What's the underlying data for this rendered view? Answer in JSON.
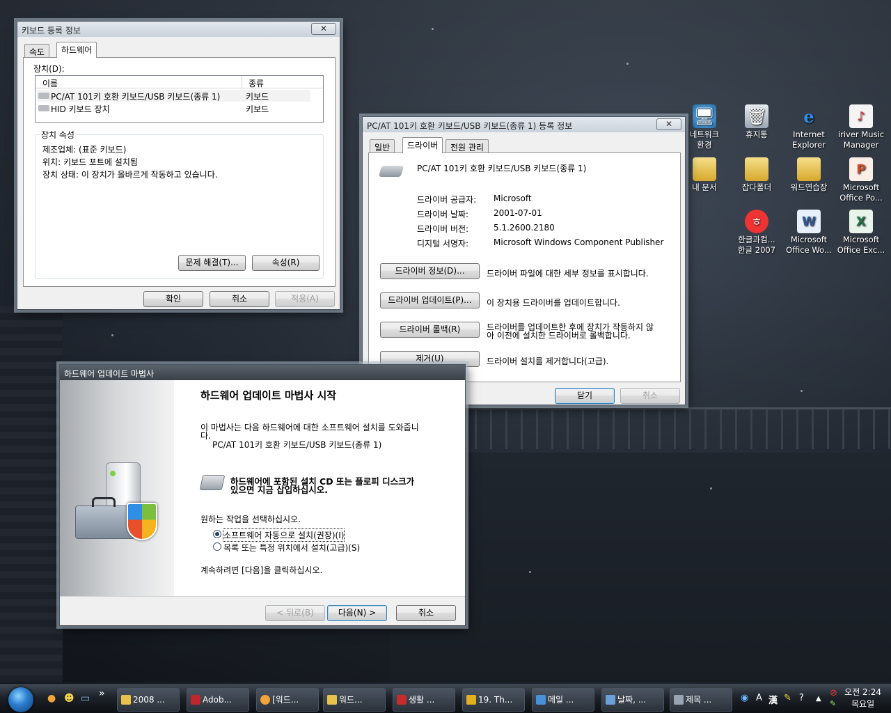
{
  "desktop": {
    "icons": [
      {
        "label_line1": "네트워크",
        "label_line2": "환경",
        "icon": "network-icon"
      },
      {
        "label_line1": "휴지통",
        "label_line2": "",
        "icon": "recycle-bin-icon"
      },
      {
        "label_line1": "Internet",
        "label_line2": "Explorer",
        "icon": "internet-explorer-icon"
      },
      {
        "label_line1": "iriver Music",
        "label_line2": "Manager",
        "icon": "iriver-icon"
      },
      {
        "label_line1": "내 문서",
        "label_line2": "",
        "icon": "my-documents-icon"
      },
      {
        "label_line1": "잡다폴더",
        "label_line2": "",
        "icon": "folder-icon"
      },
      {
        "label_line1": "워드연습장",
        "label_line2": "",
        "icon": "folder-icon"
      },
      {
        "label_line1": "Microsoft",
        "label_line2": "Office Po...",
        "icon": "powerpoint-icon"
      },
      {
        "label_line1": "한글과컴...",
        "label_line2": "한글 2007",
        "icon": "hangul-icon"
      },
      {
        "label_line1": "Microsoft",
        "label_line2": "Office Wo...",
        "icon": "word-icon"
      },
      {
        "label_line1": "Microsoft",
        "label_line2": "Office Exc...",
        "icon": "excel-icon"
      }
    ]
  },
  "kbd_props": {
    "title": "키보드 등록 정보",
    "close": "✕",
    "tabs": [
      "속도",
      "하드웨어"
    ],
    "devices_label": "장치(D):",
    "col_name": "이름",
    "col_type": "종류",
    "rows": [
      {
        "name": "PC/AT 101키 호환 키보드/USB 키보드(종류 1)",
        "type": "키보드"
      },
      {
        "name": "HID 키보드 장치",
        "type": "키보드"
      }
    ],
    "props_group": "장치 속성",
    "manufacturer": "제조업체: (표준 키보드)",
    "location": "위치: 키보드 포트에 설치됨",
    "status": "장치 상태: 이 장치가 올바르게 작동하고 있습니다.",
    "troubleshoot": "문제 해결(T)...",
    "properties": "속성(R)",
    "ok": "확인",
    "cancel": "취소",
    "apply": "적용(A)"
  },
  "drv_props": {
    "title": "PC/AT 101키 호환 키보드/USB 키보드(종류 1) 등록 정보",
    "close": "✕",
    "tabs": [
      "일반",
      "드라이버",
      "전원 관리"
    ],
    "device_name": "PC/AT 101키 호환 키보드/USB 키보드(종류 1)",
    "provider_label": "드라이버 공급자:",
    "provider": "Microsoft",
    "date_label": "드라이버 날짜:",
    "date": "2001-07-01",
    "version_label": "드라이버 버전:",
    "version": "5.1.2600.2180",
    "signer_label": "디지털 서명자:",
    "signer": "Microsoft Windows Component Publisher",
    "btn_details": "드라이버 정보(D)...",
    "desc_details": "드라이버 파일에 대한 세부 정보를 표시합니다.",
    "btn_update": "드라이버 업데이트(P)...",
    "desc_update": "이 장치용 드라이버를 업데이트합니다.",
    "btn_rollback": "드라이버 롤백(R)",
    "desc_rollback_1": "드라이버를 업데이트한 후에 장치가 작동하지 않",
    "desc_rollback_2": "아 이전에 설치한 드라이버로 롤백합니다.",
    "btn_uninstall": "제거(U)",
    "desc_uninstall": "드라이버 설치를 제거합니다(고급).",
    "close_btn": "닫기",
    "cancel": "취소"
  },
  "wizard": {
    "title": "하드웨어 업데이트 마법사",
    "heading": "하드웨어 업데이트 마법사 시작",
    "intro_1": "이 마법사는 다음 하드웨어에 대한 소프트웨어 설치를 도와줍니",
    "intro_2": "다.",
    "device": "PC/AT 101키 호환 키보드/USB 키보드(종류 1)",
    "cd_1": "하드웨어에 포함된 설치 CD 또는 플로피 디스크가",
    "cd_2": "있으면 지금 삽입하십시오.",
    "choose": "원하는 작업을 선택하십시오.",
    "opt_auto": "소프트웨어 자동으로 설치(권장)(I)",
    "opt_manual": "목록 또는 특정 위치에서 설치(고급)(S)",
    "continue": "계속하려면 [다음]을 클릭하십시오.",
    "back": "< 뒤로(B)",
    "next": "다음(N) >",
    "cancel": "취소"
  },
  "taskbar": {
    "chevron": "»",
    "buttons": [
      {
        "label": "2008 ...",
        "color": "#e8c24a"
      },
      {
        "label": "Adob...",
        "color": "#c0262d"
      },
      {
        "label": "[워드...",
        "color": "#f2a33a"
      },
      {
        "label": "워드...",
        "color": "#e8c24a"
      },
      {
        "label": "생활 ...",
        "color": "#c82b2b"
      },
      {
        "label": "19. Th...",
        "color": "#e0b020"
      },
      {
        "label": "메일 ...",
        "color": "#4a90d9"
      },
      {
        "label": "날짜, ...",
        "color": "#6aa0d8"
      },
      {
        "label": "제목 ...",
        "color": "#9aa4b0"
      }
    ],
    "tray_ime": "漢",
    "clock_time": "오전 2:24",
    "clock_day": "목요일"
  }
}
